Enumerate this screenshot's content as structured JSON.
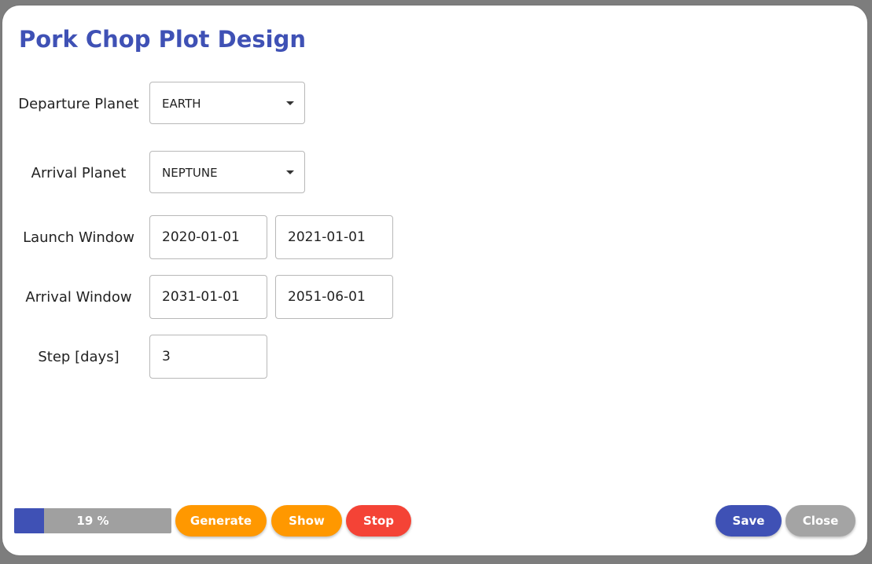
{
  "dialog": {
    "title": "Pork Chop Plot Design"
  },
  "form": {
    "departure_planet": {
      "label": "Departure Planet",
      "value": "EARTH"
    },
    "arrival_planet": {
      "label": "Arrival Planet",
      "value": "NEPTUNE"
    },
    "launch_window": {
      "label": "Launch Window",
      "start": "2020-01-01",
      "end": "2021-01-01"
    },
    "arrival_window": {
      "label": "Arrival Window",
      "start": "2031-01-01",
      "end": "2051-06-01"
    },
    "step": {
      "label": "Step [days]",
      "value": "3"
    }
  },
  "progress": {
    "percent": 19,
    "label": "19 %"
  },
  "buttons": {
    "generate": "Generate",
    "show": "Show",
    "stop": "Stop",
    "save": "Save",
    "close": "Close"
  },
  "colors": {
    "accent": "#3f51b5",
    "orange": "#ff9800",
    "red": "#f44336",
    "gray": "#a4a4a4"
  }
}
